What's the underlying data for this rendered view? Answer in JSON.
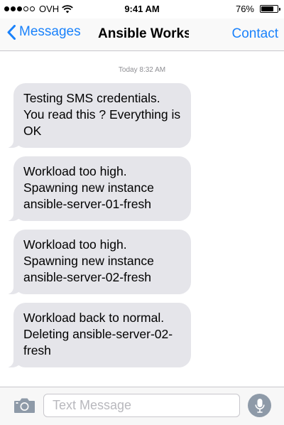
{
  "status_bar": {
    "carrier": "OVH",
    "time": "9:41 AM",
    "battery_percent": "76%",
    "battery_level": 0.76,
    "signal_bars": 3,
    "signal_total": 5
  },
  "nav": {
    "back_label": "Messages",
    "title": "Ansible Works",
    "contact_label": "Contact",
    "accent_color": "#1a82fb"
  },
  "thread": {
    "timestamp": "Today 8:32 AM",
    "messages": [
      "Testing SMS credentials. You read this ? Everything is OK",
      "Workload too high. Spawning new instance ansible-server-01-fresh",
      "Workload too high. Spawning new instance ansible-server-02-fresh",
      "Workload back to normal. Deleting ansible-server-02-fresh"
    ]
  },
  "composer": {
    "placeholder": "Text Message",
    "value": "",
    "camera_icon": "camera-icon",
    "mic_icon": "microphone-icon"
  }
}
